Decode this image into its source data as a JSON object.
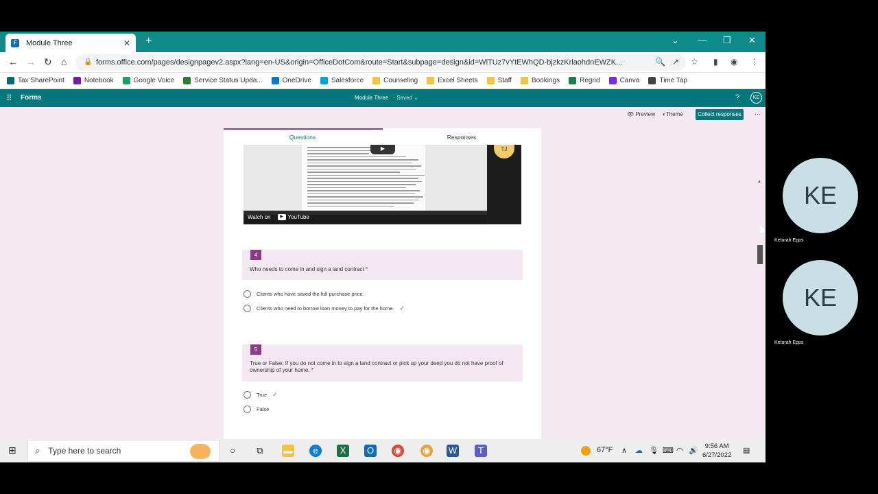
{
  "browser": {
    "tab_title": "Module Three",
    "url": "forms.office.com/pages/designpagev2.aspx?lang=en-US&origin=OfficeDotCom&route=Start&subpage=design&id=WlTUz7vYtEWhQD-bjzkzKrlaohdnEWZK...",
    "bookmarks": [
      {
        "label": "Tax SharePoint",
        "color": "#036c70"
      },
      {
        "label": "Notebook",
        "color": "#7719aa"
      },
      {
        "label": "Google Voice",
        "color": "#1aa260"
      },
      {
        "label": "Service Status Upda...",
        "color": "#2e7d32"
      },
      {
        "label": "OneDrive",
        "color": "#0078d4"
      },
      {
        "label": "Salesforce",
        "color": "#00a1e0"
      },
      {
        "label": "Counseling",
        "color": "folder"
      },
      {
        "label": "Excel Sheets",
        "color": "folder"
      },
      {
        "label": "Staff",
        "color": "folder"
      },
      {
        "label": "Bookings",
        "color": "folder"
      },
      {
        "label": "Regrid",
        "color": "#1a7f4b"
      },
      {
        "label": "Canva",
        "color": "#7d2ae8"
      },
      {
        "label": "Time Tap",
        "color": "#444444"
      }
    ]
  },
  "forms": {
    "app_name": "Forms",
    "doc_title": "Module Three",
    "status": "Saved",
    "help": "?",
    "user_initials": "KE",
    "preview": "Preview",
    "theme": "Theme",
    "collect": "Collect responses",
    "tab_questions": "Questions",
    "tab_responses": "Responses"
  },
  "video": {
    "watch_on": "Watch on",
    "youtube": "YouTube",
    "avatar_text": "TJ"
  },
  "questions": [
    {
      "number": "4",
      "text": "Who needs to come in and sign a land contract *",
      "options": [
        {
          "label": "Clients who have saved the full purchase price.",
          "correct": false
        },
        {
          "label": "Clients who need to borrow loan money to pay for the home.",
          "correct": true
        }
      ]
    },
    {
      "number": "5",
      "text": "True or False: If you do not come in to sign a land contract or pick up your deed you do not have proof of ownership of your home. *",
      "options": [
        {
          "label": "True",
          "correct": true
        },
        {
          "label": "False",
          "correct": false
        }
      ]
    }
  ],
  "taskbar": {
    "search_placeholder": "Type here to search",
    "temperature": "67°F",
    "time": "9:56 AM",
    "date": "6/27/2022"
  },
  "participants": [
    {
      "initials": "KE",
      "name": "Keturah Epps"
    },
    {
      "initials": "KE",
      "name": "Keturah Epps"
    }
  ],
  "colors": {
    "forms_teal": "#03787c",
    "accent_purple": "#8d3a88",
    "correct_green": "#3a9a3a"
  }
}
